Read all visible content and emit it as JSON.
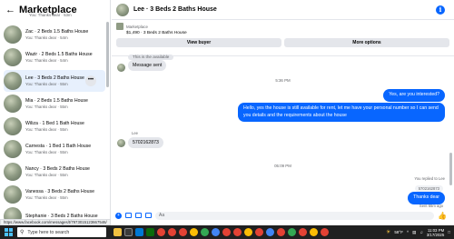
{
  "sidebar": {
    "title": "Marketplace",
    "partial_item": {
      "sub": "You: Thanks dear · 53m"
    },
    "items": [
      {
        "name": "Zac · 2 Beds 1.5 Baths House",
        "sub": "You: Thanks dear · 54m"
      },
      {
        "name": "Wazir · 2 Beds 1.5 Baths House",
        "sub": "You: Thanks dear · 54m"
      },
      {
        "name": "Lee · 3 Beds 2 Baths House",
        "sub": "You: Thanks dear · 55m"
      },
      {
        "name": "Mia · 2 Beds 1.5 Baths House",
        "sub": "You: Thanks dear · 55m"
      },
      {
        "name": "Wiliza · 1 Bed 1 Bath House",
        "sub": "You: Thanks dear · 55m"
      },
      {
        "name": "Carnesta · 1 Bed 1 Bath House",
        "sub": "You: Thanks dear · 55m"
      },
      {
        "name": "Nancy · 3 Beds 2 Baths House",
        "sub": "You: Thanks dear · 55m"
      },
      {
        "name": "Vanessa · 3 Beds 2 Baths House",
        "sub": "You: Thanks dear · 55m"
      },
      {
        "name": "Stephanie · 3 Beds 2 Baths House",
        "sub": ""
      }
    ],
    "more_label": "•••"
  },
  "chat": {
    "title": "Lee · 3 Beds 2 Baths House",
    "listing": {
      "category": "Marketplace",
      "price": "$1,490 · 3 Beds 2 Baths House",
      "view_buyer": "View buyer",
      "more_options": "More options"
    },
    "messages": {
      "cut_off": "This is the available",
      "message_sent": "Message sent",
      "time1": "5:36 PM",
      "out1": "Yes, are you interested?",
      "out2": "Hello, yes the house is still available for rent, let me have your personal number so I can send you details and the requirements about the house",
      "sender": "Lee",
      "in_number": "5702162873",
      "time2": "05:09 PM",
      "replied": "You replied to Lee",
      "quoted": "5702162873",
      "out3": "Thanks dear",
      "sent_meta": "Sent 55m ago"
    },
    "composer_placeholder": "Aa"
  },
  "status_url": "https://www.facebook.com/messages/t/7973015123667546/",
  "taskbar": {
    "search_placeholder": "Type here to search",
    "weather": "58°F",
    "time": "11:03 PM",
    "date": "3/17/2025"
  }
}
